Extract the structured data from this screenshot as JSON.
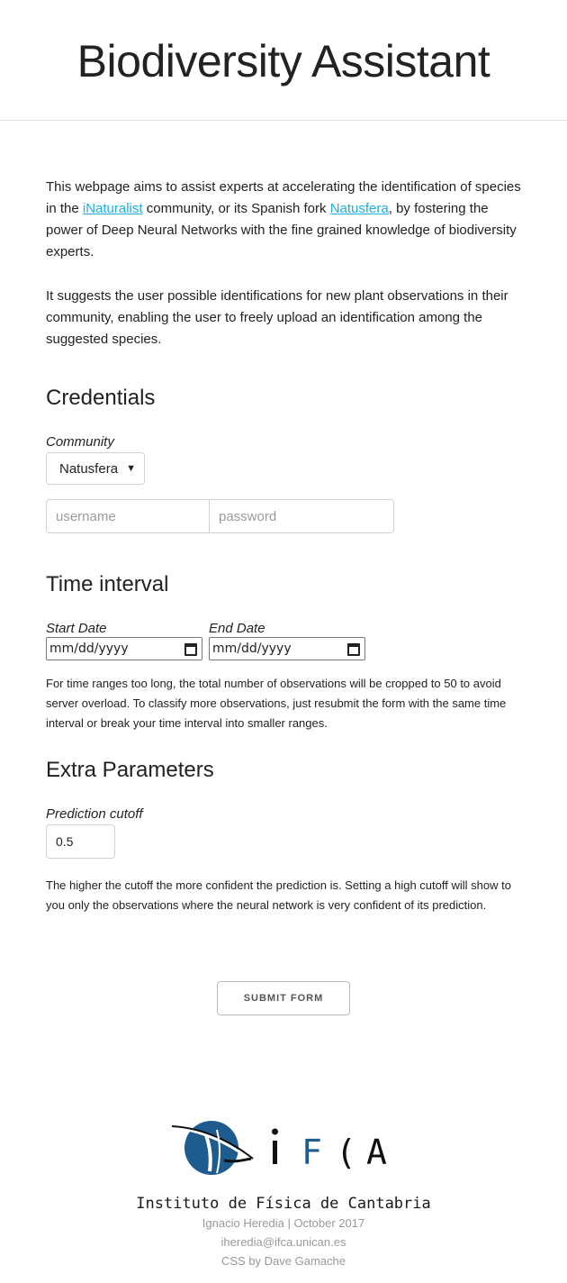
{
  "header": {
    "title": "Biodiversity Assistant"
  },
  "intro": {
    "p1": {
      "before": "This webpage aims to assist experts at accelerating the identification of species in the ",
      "link1": "iNaturalist",
      "middle": " community, or its Spanish fork ",
      "link2": "Natusfera",
      "after": ", by fostering the power of Deep Neural Networks with the fine grained knowledge of biodiversity experts."
    },
    "p2": "It suggests the user possible identifications for new plant observations in their community, enabling the user to freely upload an identification among the suggested species."
  },
  "credentials": {
    "heading": "Credentials",
    "community_label": "Community",
    "community_value": "Natusfera",
    "username_placeholder": "username",
    "password_placeholder": "password"
  },
  "time_interval": {
    "heading": "Time interval",
    "start_label": "Start Date",
    "start_value": "mm/dd/yyyy",
    "end_label": "End Date",
    "end_value": "mm/dd/yyyy",
    "note": "For time ranges too long, the total number of observations will be cropped to 50 to avoid server overload. To classify more observations, just resubmit the form with the same time interval or break your time interval into smaller ranges."
  },
  "extra": {
    "heading": "Extra Parameters",
    "cutoff_label": "Prediction cutoff",
    "cutoff_value": "0.5",
    "note": "The higher the cutoff the more confident the prediction is. Setting a high cutoff will show to you only the observations where the neural network is very confident of its prediction."
  },
  "submit_label": "SUBMIT FORM",
  "footer": {
    "logo_text": "IFCA",
    "institute": "Instituto de Física de Cantabria",
    "credit": "Ignacio Heredia | October 2017",
    "email": "iheredia@ifca.unican.es",
    "css_credit": "CSS by Dave Gamache"
  },
  "colors": {
    "link": "#1EAEDB",
    "logo_blue": "#1e5b8f"
  }
}
